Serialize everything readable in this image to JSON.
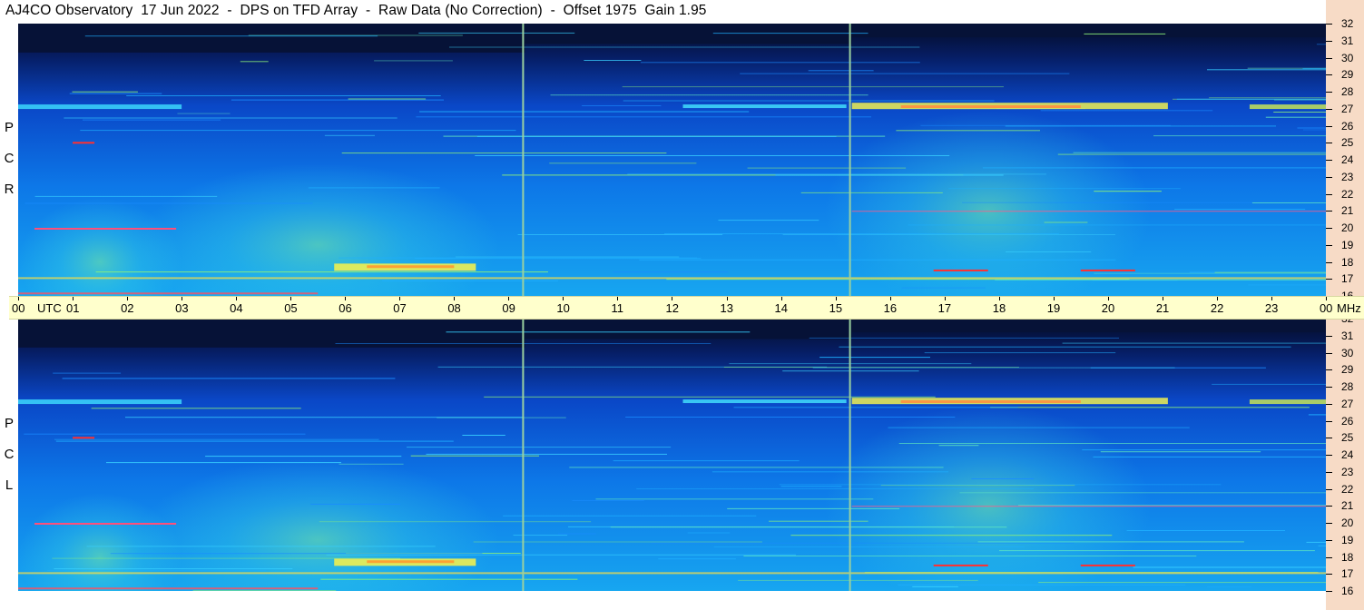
{
  "title": "AJ4CO Observatory  17 Jun 2022  -  DPS on TFD Array  -  Raw Data (No Correction)  -  Offset 1975  Gain 1.95",
  "panels": [
    {
      "polarization": "RCP",
      "letters": [
        "R",
        "C",
        "P"
      ]
    },
    {
      "polarization": "LCP",
      "letters": [
        "L",
        "C",
        "P"
      ]
    }
  ],
  "time_axis": {
    "unit": "UTC",
    "labels": [
      "00",
      "01",
      "02",
      "03",
      "04",
      "05",
      "06",
      "07",
      "08",
      "09",
      "10",
      "11",
      "12",
      "13",
      "14",
      "15",
      "16",
      "17",
      "18",
      "19",
      "20",
      "21",
      "22",
      "23",
      "00"
    ]
  },
  "freq_axis": {
    "unit": "MHz",
    "labels": [
      "32",
      "31",
      "30",
      "29",
      "28",
      "27",
      "26",
      "25",
      "24",
      "23",
      "22",
      "21",
      "20",
      "19",
      "18",
      "17",
      "16"
    ]
  },
  "colors": {
    "background_dark": "#061237",
    "spectrogram_mid": "#0a64e6",
    "spectrogram_bright": "#32d2ff",
    "emission_yellow": "#f0f050",
    "emission_red": "#ff3030",
    "time_axis_bg": "#ffffcc",
    "freq_axis_bg": "#f7dbc6"
  },
  "chart_data": {
    "type": "heatmap",
    "title": "AJ4CO Observatory  17 Jun 2022  -  DPS on TFD Array  -  Raw Data (No Correction)  -  Offset 1975  Gain 1.95",
    "x": {
      "label": "UTC",
      "range_hours": [
        0,
        24
      ]
    },
    "y": {
      "label": "MHz",
      "range": [
        16,
        32
      ]
    },
    "panels": [
      "RCP",
      "LCP"
    ],
    "vertical_markers_utc": [
      9.25,
      15.25
    ],
    "strong_bands_mhz": [
      27.1,
      17.0,
      17.8
    ]
  }
}
